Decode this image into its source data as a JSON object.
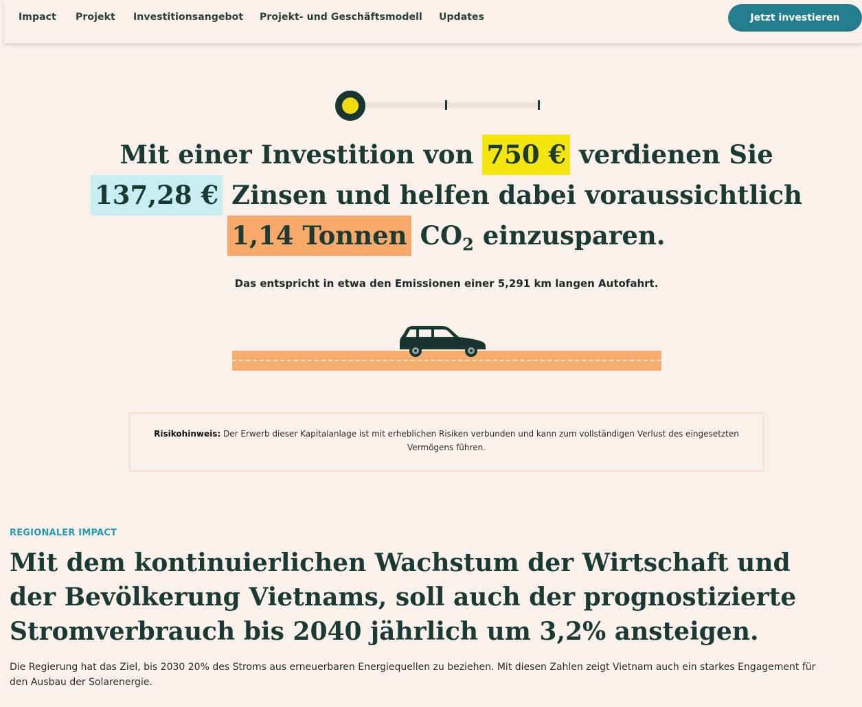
{
  "nav": {
    "items": [
      "Impact",
      "Projekt",
      "Investitionsangebot",
      "Projekt- und Geschäftsmodell",
      "Updates"
    ],
    "cta": "Jetzt investieren"
  },
  "slider": {
    "position_fraction": 0
  },
  "calculator": {
    "part1": "Mit einer Investition von",
    "investment": "750 €",
    "part2": "verdienen Sie",
    "interest": "137,28 €",
    "part3": "Zinsen und helfen dabei voraussichtlich",
    "co2_amount": "1,14 Tonnen",
    "co2_symbol": "CO",
    "co2_subscript": "2",
    "part4": "einzusparen.",
    "equivalent": "Das entspricht in etwa den Emissionen einer 5,291 km langen Autofahrt."
  },
  "risk": {
    "label": "Risikohinweis:",
    "text": "Der Erwerb dieser Kapitalanlage ist mit erheblichen Risiken verbunden und kann zum vollständigen Verlust des eingesetzten Vermögens führen."
  },
  "section": {
    "eyebrow": "REGIONALER IMPACT",
    "title": "Mit dem kontinuierlichen Wachstum der Wirtschaft und der Bevölkerung Vietnams, soll auch der prognostizierte Stromverbrauch bis 2040 jährlich um 3,2% ansteigen.",
    "body": "Die Regierung hat das Ziel, bis 2030 20% des Stroms aus erneuerbaren Energiequellen zu beziehen. Mit diesen Zahlen zeigt Vietnam auch ein starkes Engagement für den Ausbau der Solarenergie."
  },
  "colors": {
    "background": "#faf1ed",
    "primary_dark": "#1b3a33",
    "button": "#237d8c",
    "highlight_investment": "#f5e50f",
    "highlight_interest": "#c8eef2",
    "highlight_co2": "#f6a969",
    "road": "#f6ae6f",
    "eyebrow": "#2a9ab0"
  },
  "icons": [
    "car-icon",
    "slider-knob"
  ]
}
